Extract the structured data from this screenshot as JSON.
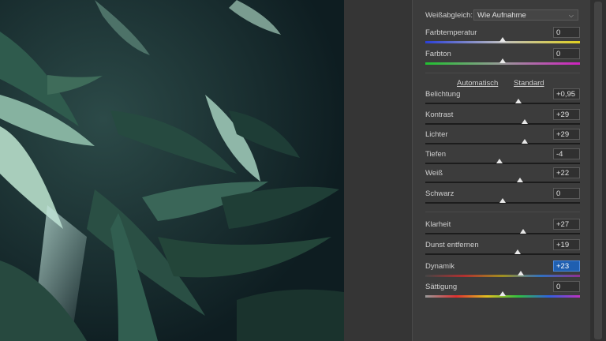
{
  "colors": {
    "panel_bg": "#3c3c3c",
    "field_active": "#1f5fb0",
    "photo_dark": "#13262a"
  },
  "panel": {
    "white_balance": {
      "label": "Weißabgleich:",
      "value": "Wie Aufnahme"
    },
    "auto_link": "Automatisch",
    "standard_link": "Standard",
    "sliders": [
      {
        "key": "temp",
        "label": "Farbtemperatur",
        "value": "0",
        "level": 0.5
      },
      {
        "key": "tint",
        "label": "Farbton",
        "value": "0",
        "level": 0.5
      },
      {
        "key": "exposure",
        "label": "Belichtung",
        "value": "+0,95",
        "level": 0.6
      },
      {
        "key": "contrast",
        "label": "Kontrast",
        "value": "+29",
        "level": 0.645
      },
      {
        "key": "highlights",
        "label": "Lichter",
        "value": "+29",
        "level": 0.645
      },
      {
        "key": "shadows",
        "label": "Tiefen",
        "value": "-4",
        "level": 0.48
      },
      {
        "key": "whites",
        "label": "Weiß",
        "value": "+22",
        "level": 0.61
      },
      {
        "key": "blacks",
        "label": "Schwarz",
        "value": "0",
        "level": 0.5
      },
      {
        "key": "clarity",
        "label": "Klarheit",
        "value": "+27",
        "level": 0.635
      },
      {
        "key": "dehaze",
        "label": "Dunst entfernen",
        "value": "+19",
        "level": 0.595
      },
      {
        "key": "vibrance",
        "label": "Dynamik",
        "value": "+23",
        "level": 0.615
      },
      {
        "key": "saturation",
        "label": "Sättigung",
        "value": "0",
        "level": 0.5
      }
    ]
  }
}
